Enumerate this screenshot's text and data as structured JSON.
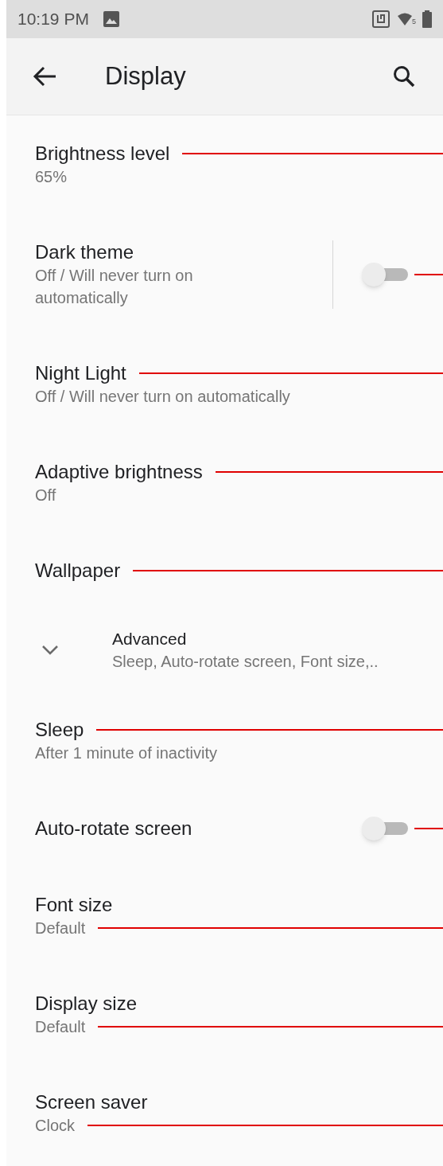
{
  "status_bar": {
    "time": "10:19 PM",
    "wifi_badge": "5"
  },
  "app_bar": {
    "title": "Display"
  },
  "items": [
    {
      "kind": "setting",
      "title": "Brightness level",
      "subtitle": "65%",
      "leader": {
        "kind": "title"
      }
    },
    {
      "kind": "toggle",
      "title": "Dark theme",
      "subtitle": "Off / Will never turn on automatically",
      "on": false,
      "divider": true,
      "leader": {
        "kind": "control"
      }
    },
    {
      "kind": "setting",
      "title": "Night Light",
      "subtitle": "Off / Will never turn on automatically",
      "leader": {
        "kind": "title"
      }
    },
    {
      "kind": "setting",
      "title": "Adaptive brightness",
      "subtitle": "Off",
      "leader": {
        "kind": "title"
      }
    },
    {
      "kind": "setting",
      "title": "Wallpaper",
      "leader": {
        "kind": "title"
      }
    },
    {
      "kind": "expander",
      "title": "Advanced",
      "subtitle": "Sleep, Auto-rotate screen, Font size,..",
      "expanded": false
    },
    {
      "kind": "setting",
      "title": "Sleep",
      "subtitle": "After 1 minute of inactivity",
      "leader": {
        "kind": "title"
      }
    },
    {
      "kind": "toggle",
      "title": "Auto-rotate screen",
      "on": false,
      "divider": false,
      "leader": {
        "kind": "control"
      }
    },
    {
      "kind": "setting",
      "title": "Font size",
      "subtitle": "Default",
      "leader": {
        "kind": "subtitle"
      }
    },
    {
      "kind": "setting",
      "title": "Display size",
      "subtitle": "Default",
      "leader": {
        "kind": "subtitle"
      }
    },
    {
      "kind": "setting",
      "title": "Screen saver",
      "subtitle": "Clock",
      "leader": {
        "kind": "subtitle"
      }
    }
  ]
}
